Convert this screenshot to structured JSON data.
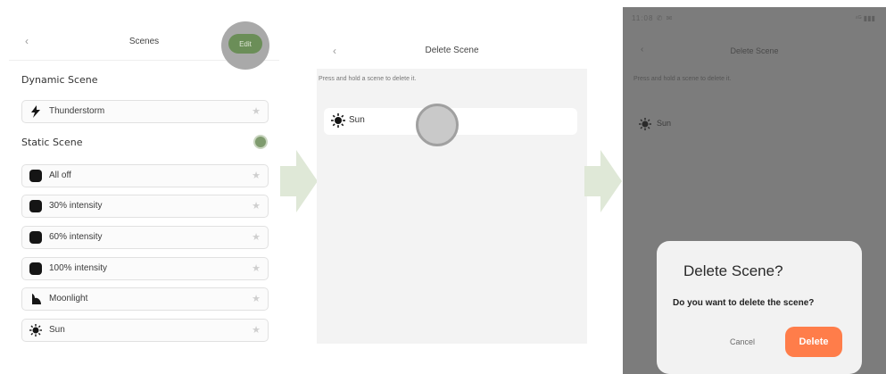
{
  "screen1": {
    "back": "‹",
    "title": "Scenes",
    "edit_label": "Edit",
    "dynamic_heading": "Dynamic Scene",
    "static_heading": "Static Scene",
    "dynamic_items": [
      {
        "label": "Thunderstorm",
        "icon": "lightning-icon"
      }
    ],
    "static_items": [
      {
        "label": "All off",
        "icon": "rounded-square-icon"
      },
      {
        "label": "30% intensity",
        "icon": "rounded-square-icon"
      },
      {
        "label": "60% intensity",
        "icon": "rounded-square-icon"
      },
      {
        "label": "100% intensity",
        "icon": "rounded-square-icon"
      },
      {
        "label": "Moonlight",
        "icon": "moon-icon"
      },
      {
        "label": "Sun",
        "icon": "sun-icon"
      }
    ],
    "star": "★"
  },
  "screen2": {
    "back": "‹",
    "title": "Delete Scene",
    "hint": "Press and hold a scene to delete it.",
    "item": {
      "label": "Sun",
      "icon": "sun-icon"
    }
  },
  "screen3": {
    "status_left": "11:08 ✆ ✉",
    "status_right": "⁴ᴳ ▮▮▮",
    "back": "‹",
    "title": "Delete Scene",
    "hint": "Press and hold a scene to delete it.",
    "item": {
      "label": "Sun",
      "icon": "sun-icon"
    },
    "dialog": {
      "title": "Delete Scene?",
      "message": "Do you want to delete the scene?",
      "cancel": "Cancel",
      "delete": "Delete"
    }
  },
  "colors": {
    "accent_green": "#6b8e58",
    "delete_orange": "#ff7d4a",
    "arrow": "#dfe8d7",
    "overlay": "#7c7c7c"
  }
}
